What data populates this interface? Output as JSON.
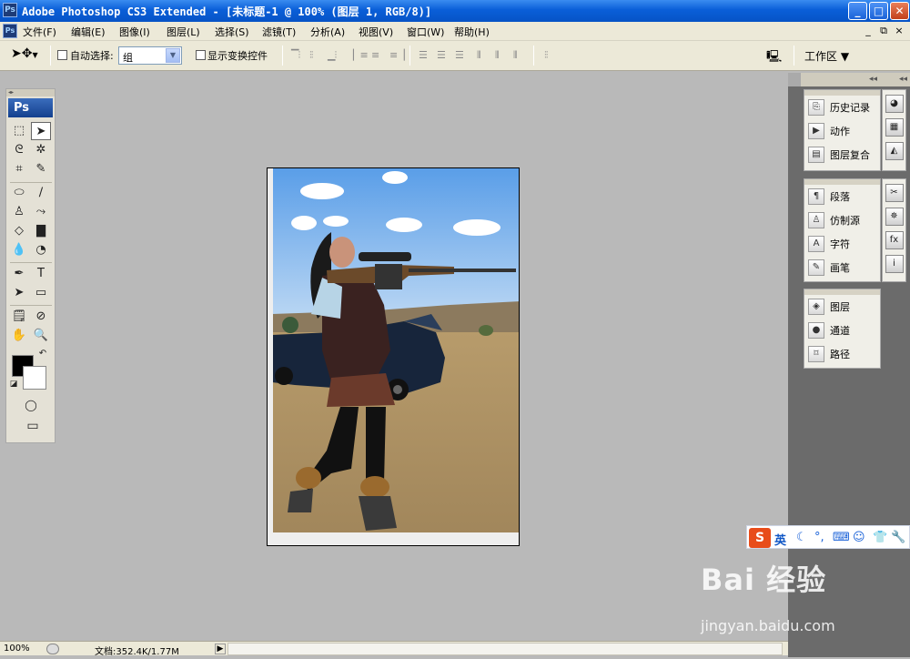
{
  "window": {
    "title": "Adobe Photoshop CS3 Extended - [未标题-1 @ 100% (图层 1, RGB/8)]",
    "app_icon": "Ps",
    "minimize": "_",
    "maximize": "□",
    "close": "✕"
  },
  "menubar": {
    "items": [
      {
        "label": "文件(F)"
      },
      {
        "label": "编辑(E)"
      },
      {
        "label": "图像(I)"
      },
      {
        "label": "图层(L)"
      },
      {
        "label": "选择(S)"
      },
      {
        "label": "滤镜(T)"
      },
      {
        "label": "分析(A)"
      },
      {
        "label": "视图(V)"
      },
      {
        "label": "窗口(W)"
      },
      {
        "label": "帮助(H)"
      }
    ],
    "doc_minimize": "_",
    "doc_restore": "⧉",
    "doc_close": "×"
  },
  "options": {
    "auto_select_label": "自动选择:",
    "auto_select_value": "组",
    "show_transform_label": "显示变换控件",
    "workspace_label": "工作区 ▼"
  },
  "toolbox": {
    "logo": "Ps"
  },
  "panels": {
    "group1": [
      {
        "label": "历史记录",
        "icon": "history-icon"
      },
      {
        "label": "动作",
        "icon": "actions-icon"
      },
      {
        "label": "图层复合",
        "icon": "layer-comps-icon"
      }
    ],
    "group2": [
      {
        "label": "段落",
        "icon": "paragraph-icon"
      },
      {
        "label": "仿制源",
        "icon": "clone-source-icon"
      },
      {
        "label": "字符",
        "icon": "character-icon"
      },
      {
        "label": "画笔",
        "icon": "brushes-icon"
      }
    ],
    "group3": [
      {
        "label": "图层",
        "icon": "layers-icon"
      },
      {
        "label": "通道",
        "icon": "channels-icon"
      },
      {
        "label": "路径",
        "icon": "paths-icon"
      }
    ]
  },
  "ime": {
    "logo": "S",
    "lang": "英"
  },
  "status": {
    "zoom": "100%",
    "doc_info": "文档:352.4K/1.77M"
  },
  "watermark": {
    "brand": "Bai  经验",
    "url": "jingyan.baidu.com"
  },
  "colors": {
    "titlebar": "#0a5fd8",
    "chrome": "#ece9d8",
    "workspace": "#b9b9b9",
    "dock": "#6b6b6b"
  }
}
